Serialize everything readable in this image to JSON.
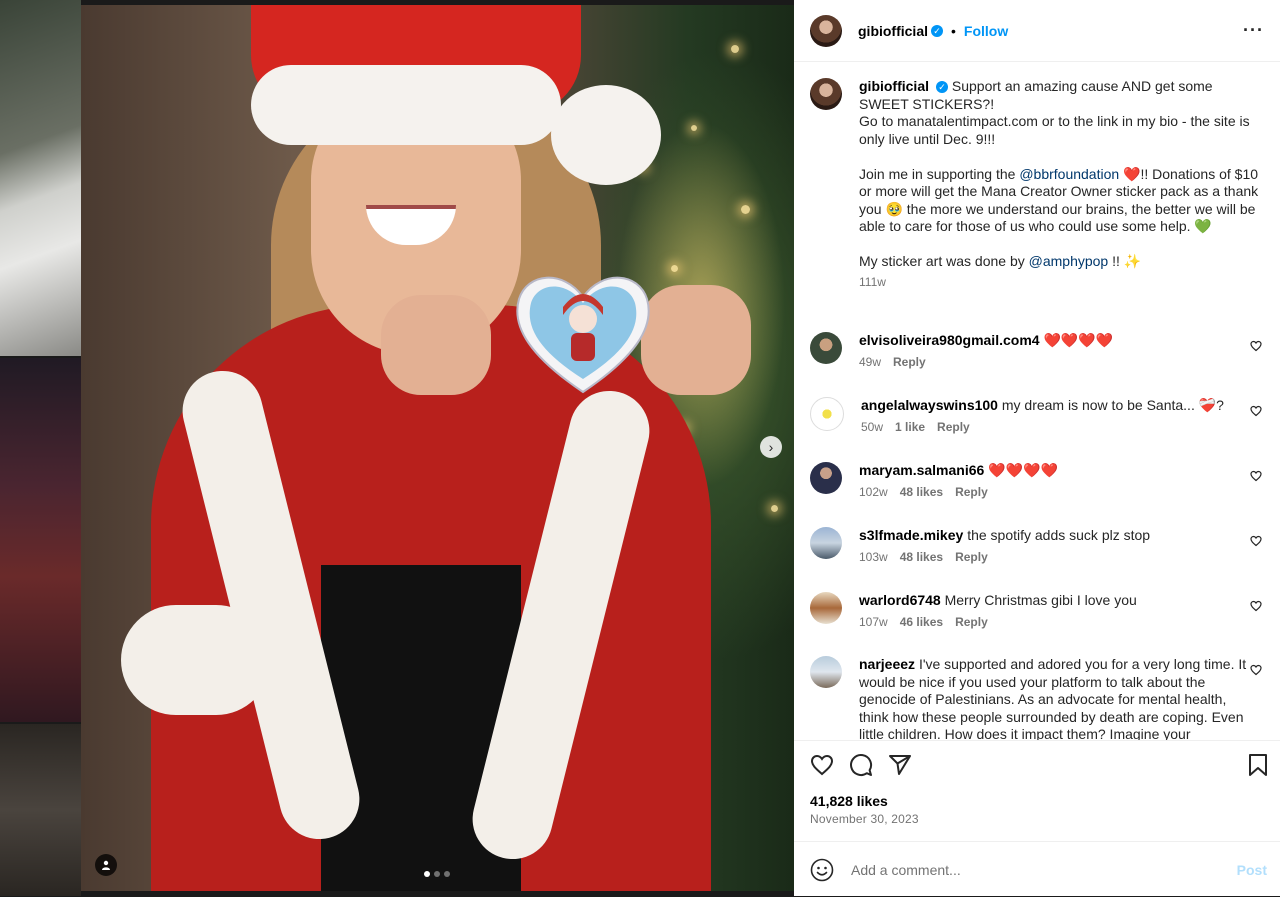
{
  "post": {
    "author": "gibiofficial",
    "follow_label": "Follow",
    "separator": "•",
    "more_label": "···",
    "verified_mark": "✓",
    "caption_lines": [
      "Support an amazing cause AND get some",
      "SWEET STICKERS?!",
      "Go to manatalentimpact.com or to the link in my bio - the site is only live until Dec. 9!!!"
    ],
    "caption_para2_a": "Join me in supporting the ",
    "caption_mention1": "@bbrfoundation",
    "caption_para2_b": " ❤️!! Donations of $10 or more will get the Mana Creator Owner sticker pack as a thank you 🥹 the more we understand our brains, the better we will be able to care for those of us who could use some help. 💚",
    "caption_para3_a": "My sticker art was done by ",
    "caption_mention2": "@amphypop",
    "caption_para3_b": " !! ✨",
    "caption_age": "111w",
    "likes": "41,828 likes",
    "date": "November 30, 2023"
  },
  "comments": [
    {
      "user": "elvisoliveira980gmail.com4",
      "text": "❤️❤️❤️❤️",
      "age": "49w",
      "likes": "",
      "reply": "Reply"
    },
    {
      "user": "angelalwayswins100",
      "text": "my dream is now to be Santa... ❤️‍🩹?",
      "age": "50w",
      "likes": "1 like",
      "reply": "Reply"
    },
    {
      "user": "maryam.salmani66",
      "text": "❤️❤️❤️❤️",
      "age": "102w",
      "likes": "48 likes",
      "reply": "Reply"
    },
    {
      "user": "s3lfmade.mikey",
      "text": "the spotify adds suck plz stop",
      "age": "103w",
      "likes": "48 likes",
      "reply": "Reply"
    },
    {
      "user": "warlord6748",
      "text": "Merry Christmas gibi I love you",
      "age": "107w",
      "likes": "46 likes",
      "reply": "Reply"
    },
    {
      "user": "narjeeez",
      "text": "I've supported and adored you for a very long time. It would be nice if you used your platform to talk about the genocide of Palestinians. As an advocate for mental health, think how these people surrounded by death are coping. Even little children. How does it impact them? Imagine your",
      "age": "",
      "likes": "",
      "reply": ""
    }
  ],
  "composer": {
    "placeholder": "Add a comment...",
    "post_label": "Post"
  },
  "icons": [
    "heart-icon",
    "comment-icon",
    "share-icon",
    "bookmark-icon",
    "emoji-icon",
    "chevron-right-icon",
    "tag-user-icon",
    "verified-icon",
    "more-icon"
  ],
  "carousel": {
    "current": 1,
    "total": 3
  },
  "colors": {
    "accent": "#0095f6",
    "mention": "#00376b",
    "muted": "#737373",
    "post_disabled": "#b2dffc"
  }
}
